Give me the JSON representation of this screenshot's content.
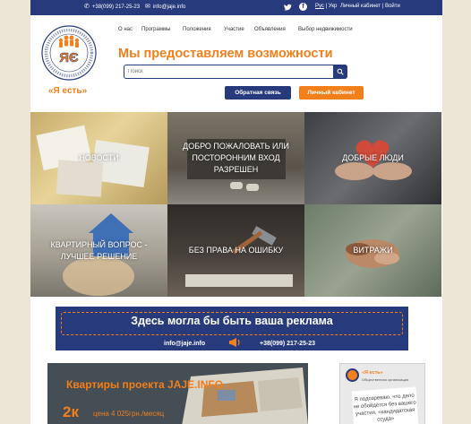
{
  "topbar": {
    "phone": "+38(099) 217-25-23",
    "email": "info@jaje.info",
    "lang_ru": "Рус",
    "lang_sep": "|",
    "lang_ua": "Укр",
    "cabinet": "Личный кабинет",
    "cabinet_sep": "|",
    "login": "Войти"
  },
  "logo": {
    "name": "«Я есть»",
    "ring_text": "ГРОМАДСЬКА ОРГАНІЗАЦІЯ · NON-GOVERNMENTAL ORGANIZATION",
    "monogram": "ЯЄ"
  },
  "nav": [
    "О нас",
    "Программы",
    "Положения",
    "Участие",
    "Объявления",
    "Выбор недвижимости"
  ],
  "headline": "Мы предоставляем возможности",
  "search": {
    "placeholder": "Поиск"
  },
  "buttons": {
    "feedback": "Обратная связь",
    "cabinet": "Личный кабинет"
  },
  "tiles": [
    "НОВОСТИ",
    "ДОБРО ПОЖАЛОВАТЬ ИЛИ ПОСТОРОННИМ ВХОД РАЗРЕШЕН",
    "ДОБРЫЕ ЛЮДИ",
    "КВАРТИРНЫЙ ВОПРОС - ЛУЧШЕЕ РЕШЕНИЕ",
    "БЕЗ ПРАВА НА ОШИБКУ",
    "ВИТРАЖИ"
  ],
  "banner": {
    "text": "Здесь могла бы быть ваша реклама",
    "email": "info@jaje.info",
    "phone": "+38(099) 217-25-23"
  },
  "promo": {
    "title": "Квартиры проекта JAJE.INFO",
    "amount": "2к",
    "price": "цена 4 025грн./месяц"
  },
  "side": {
    "name": "«Я есть»",
    "org": "Общественная организация",
    "quote": "Я подозреваю, что дело не обойдётся без вашего участия, «кандидатская ссуда»"
  },
  "colors": {
    "brand_blue": "#273a7c",
    "brand_orange": "#f07f1c"
  }
}
